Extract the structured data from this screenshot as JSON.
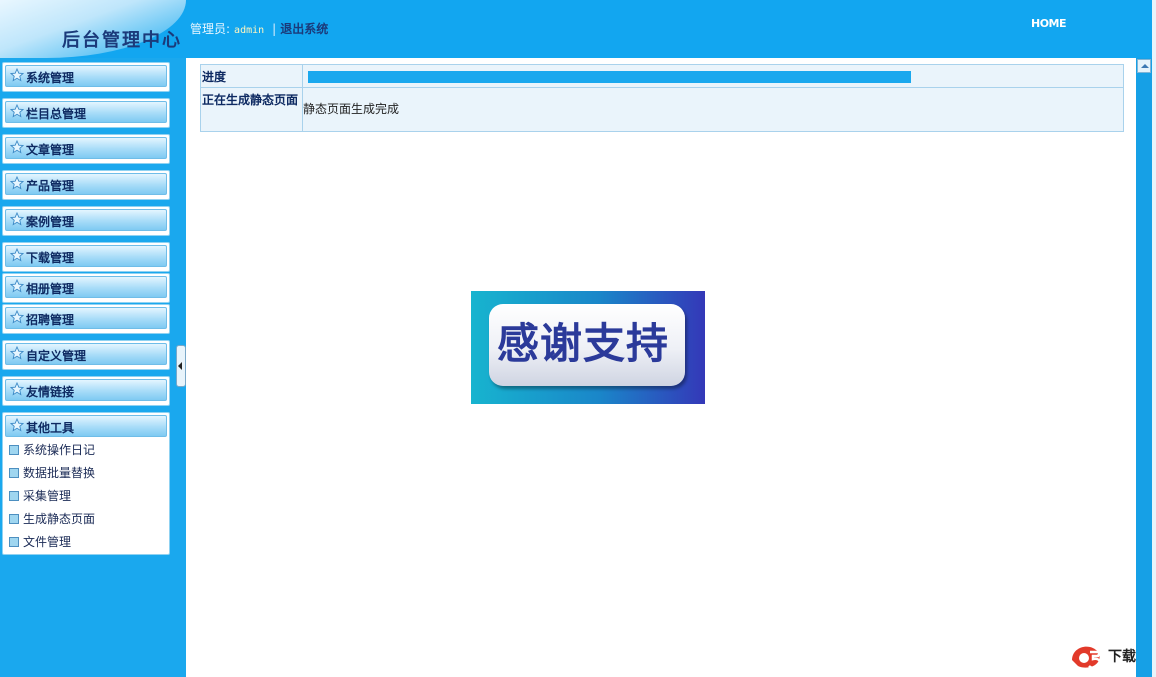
{
  "header": {
    "logo_text": "后台管理中心",
    "admin_label": "管理员:",
    "admin_name": "admin",
    "separator": "|",
    "logout": "退出系统",
    "home": "HOME"
  },
  "sidebar": {
    "menus": [
      {
        "label": "系统管理"
      },
      {
        "label": "栏目总管理"
      },
      {
        "label": "文章管理"
      },
      {
        "label": "产品管理"
      },
      {
        "label": "案例管理"
      },
      {
        "label": "下载管理"
      },
      {
        "label": "相册管理"
      },
      {
        "label": "招聘管理"
      },
      {
        "label": "自定义管理"
      },
      {
        "label": "友情链接"
      }
    ],
    "expanded_menu": {
      "label": "其他工具",
      "items": [
        "系统操作日记",
        "数据批量替换",
        "采集管理",
        "生成静态页面",
        "文件管理"
      ]
    }
  },
  "main": {
    "progress_label": "进度",
    "progress_percent": 65,
    "generating_label": "正在生成静态页面",
    "status_message": "静态页面生成完成",
    "thanks_text": "感谢支持"
  },
  "watermark": {
    "text": "下载"
  },
  "colors": {
    "background": "#1aa8ee",
    "progress": "#1aa8ee",
    "menu_text": "#0e2a62"
  }
}
